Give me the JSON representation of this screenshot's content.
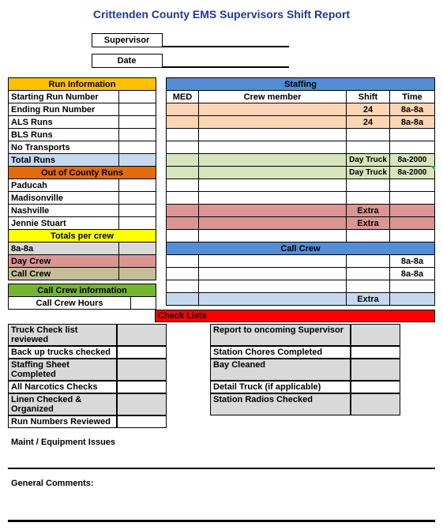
{
  "title": "Crittenden County EMS Supervisors Shift Report",
  "header": {
    "supervisor_label": "Supervisor",
    "date_label": "Date"
  },
  "left": {
    "run_info": "Run Information",
    "start_run": "Starting Run Number",
    "end_run": "Ending Run Number",
    "als": "ALS Runs",
    "bls": "BLS Runs",
    "no_trans": "No Transports",
    "total": "Total Runs",
    "out_county": "Out of County Runs",
    "paducah": "Paducah",
    "madisonville": "Madisonville",
    "nashville": "Nashville",
    "jennie": "Jennie Stuart",
    "totals_crew": "Totals per crew",
    "shift_8a": "8a-8a",
    "day_crew": "Day Crew",
    "call_crew": "Call Crew",
    "cc_info": "Call Crew information",
    "cc_hours": "Call Crew Hours"
  },
  "right": {
    "staffing": "Staffing",
    "med": "MED",
    "crew_member": "Crew member",
    "shift": "Shift",
    "time": "Time",
    "v24": "24",
    "t8a8a": "8a-8a",
    "day_truck": "Day Truck",
    "t8a2000": "8a-2000",
    "extra": "Extra",
    "call_crew": "Call Crew"
  },
  "check": {
    "header": "Check Lists",
    "a1": "Truck Check list reviewed",
    "a2": "Back up trucks checked",
    "a3": "Staffing Sheet Completed",
    "a4": "All Narcotics Checks",
    "a5": "Linen Checked & Organized",
    "a6": "Run Numbers Reviewed",
    "b1": "Report to oncoming Supervisor",
    "b2": "Station Chores Completed",
    "b3": "Bay Cleaned",
    "b4": "Detail Truck (if applicable)",
    "b5": "Station Radios Checked"
  },
  "footer": {
    "maint": "Maint / Equipment Issues",
    "comments": "General Comments:"
  }
}
